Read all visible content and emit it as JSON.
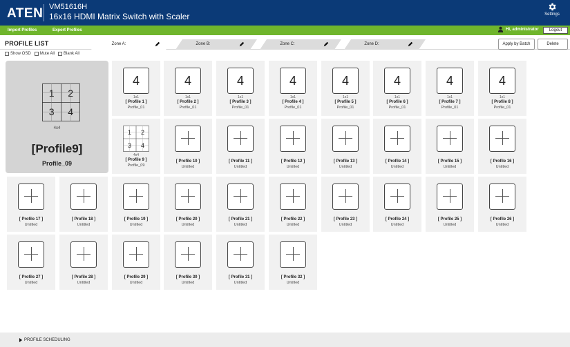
{
  "header": {
    "logo": "ATEN",
    "model": "VM51616H",
    "product": "16x16 HDMI Matrix Switch with Scaler",
    "settings_label": "Settings"
  },
  "toolbar": {
    "import_label": "Import Profiles",
    "export_label": "Export Profiles",
    "user_label": "Hi, administrator",
    "logout_label": "Logout"
  },
  "profile_list": {
    "title": "PROFILE LIST",
    "zones": [
      {
        "label": "Zone A:"
      },
      {
        "label": "Zone B:"
      },
      {
        "label": "Zone C:"
      },
      {
        "label": "Zone D:"
      }
    ],
    "apply_label": "Apply by Batch",
    "delete_label": "Delete",
    "options": [
      {
        "label": "Show OSD"
      },
      {
        "label": "Mute All"
      },
      {
        "label": "Blank All"
      }
    ]
  },
  "selected_profile": {
    "layout_size": "4x4",
    "grid_numbers": [
      "1",
      "2",
      "3",
      "4"
    ],
    "name": "[Profile9]",
    "sub": "Profile_09"
  },
  "profiles": [
    {
      "icon": "4",
      "size": "1x1",
      "name": "[ Profile 1 ]",
      "sub": "Profile_01"
    },
    {
      "icon": "4",
      "size": "1x1",
      "name": "[ Profile 2 ]",
      "sub": "Profile_01"
    },
    {
      "icon": "4",
      "size": "1x1",
      "name": "[ Profile 3 ]",
      "sub": "Profile_01"
    },
    {
      "icon": "4",
      "size": "1x1",
      "name": "[ Profile 4 ]",
      "sub": "Profile_01"
    },
    {
      "icon": "4",
      "size": "1x1",
      "name": "[ Profile 5 ]",
      "sub": "Profile_01"
    },
    {
      "icon": "4",
      "size": "1x1",
      "name": "[ Profile 6 ]",
      "sub": "Profile_01"
    },
    {
      "icon": "4",
      "size": "1x1",
      "name": "[ Profile 7 ]",
      "sub": "Profile_01"
    },
    {
      "icon": "4",
      "size": "1x1",
      "name": "[ Profile 8 ]",
      "sub": "Profile_01"
    },
    {
      "icon": "grid",
      "size": "4x4",
      "name": "[ Profile 9 ]",
      "sub": "Profile_09",
      "grid_numbers": [
        "1",
        "2",
        "3",
        "4"
      ]
    },
    {
      "icon": "plus",
      "name": "[ Profile 10 ]",
      "sub": "Untitled"
    },
    {
      "icon": "plus",
      "name": "[ Profile 11 ]",
      "sub": "Untitled"
    },
    {
      "icon": "plus",
      "name": "[ Profile 12 ]",
      "sub": "Untitled"
    },
    {
      "icon": "plus",
      "name": "[ Profile 13 ]",
      "sub": "Untitled"
    },
    {
      "icon": "plus",
      "name": "[ Profile 14 ]",
      "sub": "Untitled"
    },
    {
      "icon": "plus",
      "name": "[ Profile 15 ]",
      "sub": "Untitled"
    },
    {
      "icon": "plus",
      "name": "[ Profile 16 ]",
      "sub": "Untitled"
    },
    {
      "icon": "plus",
      "name": "[ Profile 17 ]",
      "sub": "Untitled"
    },
    {
      "icon": "plus",
      "name": "[ Profile 18 ]",
      "sub": "Untitled"
    },
    {
      "icon": "plus",
      "name": "[ Profile 19 ]",
      "sub": "Untitled"
    },
    {
      "icon": "plus",
      "name": "[ Profile 20 ]",
      "sub": "Untitled"
    },
    {
      "icon": "plus",
      "name": "[ Profile 21 ]",
      "sub": "Untitled"
    },
    {
      "icon": "plus",
      "name": "[ Profile 22 ]",
      "sub": "Untitled"
    },
    {
      "icon": "plus",
      "name": "[ Profile 23 ]",
      "sub": "Untitled"
    },
    {
      "icon": "plus",
      "name": "[ Profile 24 ]",
      "sub": "Untitled"
    },
    {
      "icon": "plus",
      "name": "[ Profile 25 ]",
      "sub": "Untitled"
    },
    {
      "icon": "plus",
      "name": "[ Profile 26 ]",
      "sub": "Untitled"
    },
    {
      "icon": "plus",
      "name": "[ Profile 27 ]",
      "sub": "Untitled"
    },
    {
      "icon": "plus",
      "name": "[ Profile 28 ]",
      "sub": "Untitled"
    },
    {
      "icon": "plus",
      "name": "[ Profile 29 ]",
      "sub": "Untitled"
    },
    {
      "icon": "plus",
      "name": "[ Profile 30 ]",
      "sub": "Untitled"
    },
    {
      "icon": "plus",
      "name": "[ Profile 31 ]",
      "sub": "Untitled"
    },
    {
      "icon": "plus",
      "name": "[ Profile 32 ]",
      "sub": "Untitled"
    }
  ],
  "footer": {
    "scheduling_label": "PROFILE SCHEDULING"
  },
  "colors": {
    "header_bg": "#0b3a77",
    "green_bar": "#6fb52c",
    "tile_bg": "#f1f1f1",
    "selected_tile_bg": "#d4d4d4"
  },
  "icons": {
    "settings": "gear-icon",
    "user": "user-icon",
    "zone_edit": "pencil-icon",
    "empty_profile": "plus-icon",
    "scheduling": "triangle-right-icon"
  }
}
